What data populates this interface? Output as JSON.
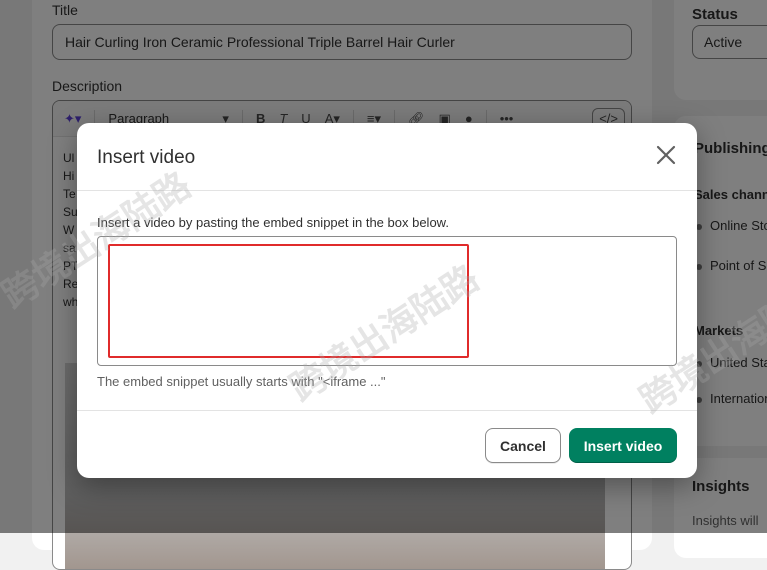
{
  "product": {
    "title_label": "Title",
    "title_value": "Hair Curling Iron Ceramic Professional Triple Barrel Hair Curler",
    "description_label": "Description",
    "toolbar_paragraph": "Paragraph",
    "editor_lines": [
      "Ul",
      "Hi",
      "Te",
      "Su",
      "W",
      "sa",
      "PT",
      "Re",
      "wh"
    ]
  },
  "sidebar": {
    "status_title": "Status",
    "status_value": "Active",
    "publishing_title": "Publishing",
    "sales_channels_label": "Sales channe",
    "sales_channels": [
      "Online Sto",
      "Point of S"
    ],
    "markets_label": "Markets",
    "markets": [
      "United Sta",
      "Internation"
    ],
    "insights_title": "Insights",
    "insights_text": "Insights will"
  },
  "modal": {
    "title": "Insert video",
    "description": "Insert a video by pasting the embed snippet in the box below.",
    "textarea_value": "",
    "help_text": "The embed snippet usually starts with \"<iframe ...\"",
    "cancel_label": "Cancel",
    "insert_label": "Insert video"
  },
  "watermark": {
    "text": "跨境出海陆路"
  },
  "colors": {
    "primary_button": "#008060",
    "highlight": "#e02b2b",
    "overlay": "rgba(0,0,0,0.5)"
  }
}
